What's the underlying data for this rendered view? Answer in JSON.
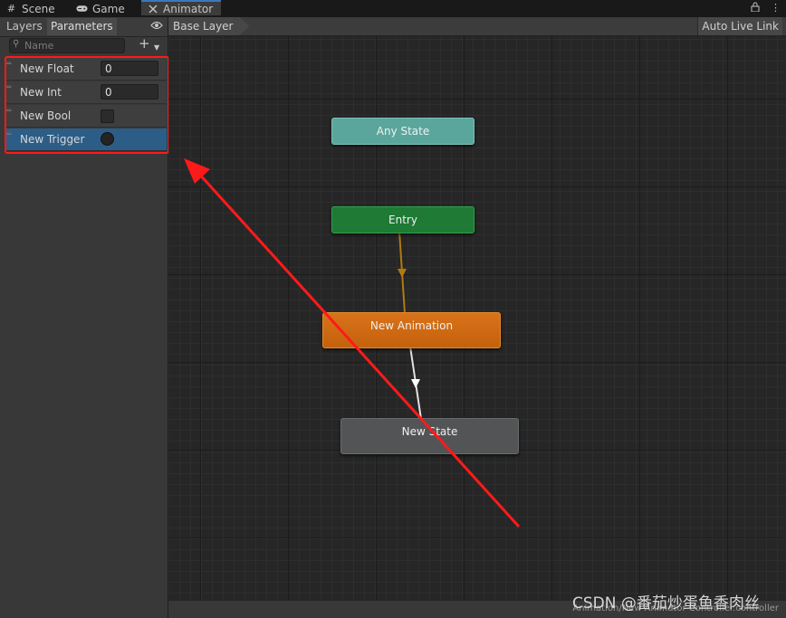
{
  "tabs": [
    {
      "label": "Scene",
      "icon": "scene-grid-icon",
      "active": false
    },
    {
      "label": "Game",
      "icon": "gamepad-icon",
      "active": false
    },
    {
      "label": "Animator",
      "icon": "animator-icon",
      "active": true
    }
  ],
  "left_panel": {
    "subtabs": [
      "Layers",
      "Parameters"
    ],
    "selected_subtab": "Parameters",
    "search_placeholder": "Name",
    "parameters": [
      {
        "name": "New Float",
        "type": "float",
        "value": "0"
      },
      {
        "name": "New Int",
        "type": "int",
        "value": "0"
      },
      {
        "name": "New Bool",
        "type": "bool",
        "value": false
      },
      {
        "name": "New Trigger",
        "type": "trigger",
        "selected": true
      }
    ]
  },
  "graph": {
    "breadcrumb": "Base Layer",
    "live_link": "Auto Live Link",
    "states": {
      "any_state": "Any State",
      "entry": "Entry",
      "new_animation": "New Animation",
      "new_state": "New State"
    },
    "status_path": "Animation/New Animator Controller.controller"
  },
  "colors": {
    "any_state": "#5aa69c",
    "entry": "#1e7a34",
    "default_state": "#c8680e",
    "state": "#535456",
    "selection": "#2c5d87",
    "annotation": "#ff1a1a"
  },
  "watermark": "CSDN @番茄炒蛋鱼香肉丝"
}
